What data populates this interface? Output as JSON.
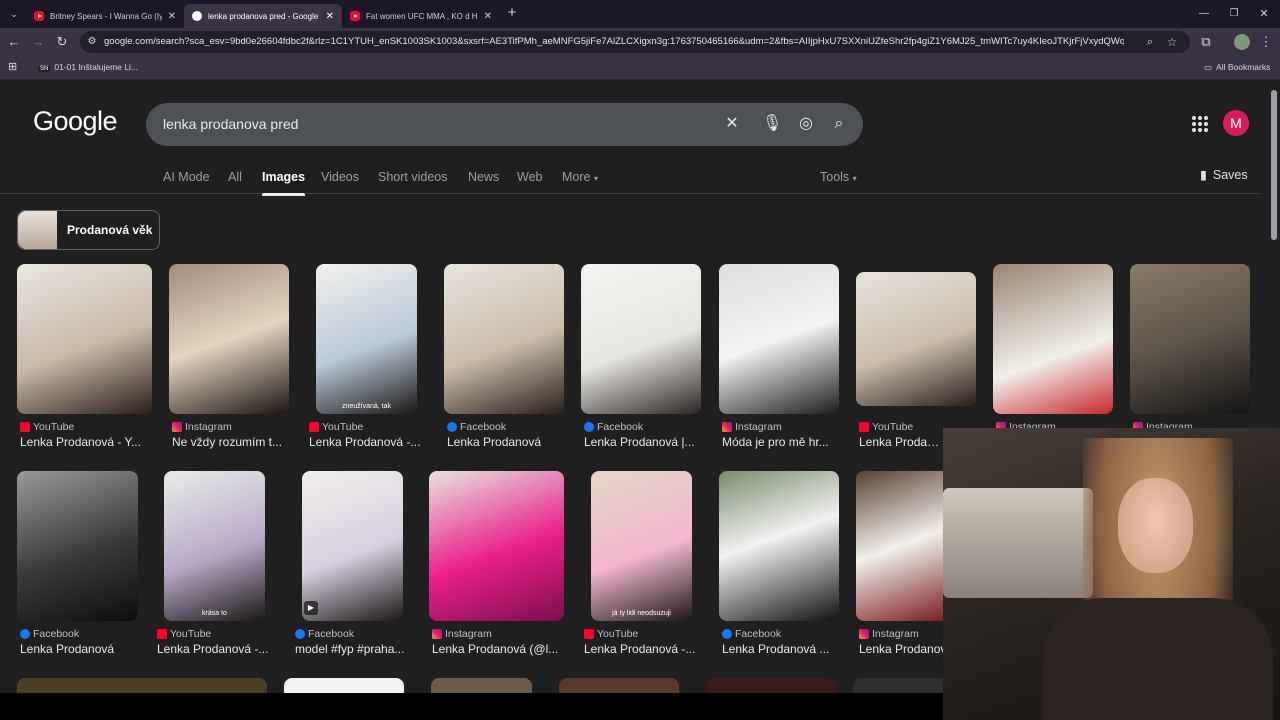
{
  "browser": {
    "tabs": [
      {
        "title": "Britney Spears - I Wanna Go (Iy",
        "favicon": "youtube-icon",
        "active": false
      },
      {
        "title": "lenka prodanova pred - Google",
        "favicon": "google-icon",
        "active": true
      },
      {
        "title": "Fat women UFC MMA , KO d H",
        "favicon": "youtube-icon",
        "active": false
      }
    ],
    "new_tab": "+",
    "url": "google.com/search?sca_esv=9bd0e26604fdbc2f&rlz=1C1YTUH_enSK1003SK1003&sxsrf=AE3TifPMh_aeMNFG5jiFe7AlZLCXigxn3g:1763750465166&udm=2&fbs=AIIjpHxU7SXXniUZfeShr2fp4giZ1Y6MJ25_tmWITc7uy4KIeoJTKjrFjVxydQWqI2NcOhYPUR...",
    "bookmarks": {
      "item": "01-01 Inštalujeme Li...",
      "all": "All Bookmarks",
      "item_badge": "SN"
    }
  },
  "google": {
    "logo": "Google",
    "query": "lenka prodanova pred",
    "avatar_letter": "M",
    "nav_tabs": [
      "AI Mode",
      "All",
      "Images",
      "Videos",
      "Short videos",
      "News",
      "Web",
      "More"
    ],
    "selected_tab": "Images",
    "tools": "Tools",
    "saves": "Saves",
    "chip": "Prodanová věk",
    "results_row1": [
      {
        "source": "YouTube",
        "icon": "youtube",
        "caption": "Lenka Prodanová - Y..."
      },
      {
        "source": "Instagram",
        "icon": "instagram",
        "caption": "Ne vždy rozumím t..."
      },
      {
        "source": "YouTube",
        "icon": "youtube",
        "caption": "Lenka Prodanová -...",
        "overlay": "zneužívaná, tak"
      },
      {
        "source": "Facebook",
        "icon": "facebook",
        "caption": "Lenka Prodanová"
      },
      {
        "source": "Facebook",
        "icon": "facebook",
        "caption": "Lenka Prodanová |..."
      },
      {
        "source": "Instagram",
        "icon": "instagram",
        "caption": "Móda je pro mě hr..."
      },
      {
        "source": "YouTube",
        "icon": "youtube",
        "caption": "Lenka Prodanová"
      },
      {
        "source": "Instagram",
        "icon": "instagram",
        "caption": ""
      },
      {
        "source": "Instagram",
        "icon": "instagram",
        "caption": ""
      }
    ],
    "results_row2": [
      {
        "source": "Facebook",
        "icon": "facebook",
        "caption": "Lenka Prodanová"
      },
      {
        "source": "YouTube",
        "icon": "youtube",
        "caption": "Lenka Prodanová -...",
        "overlay": "krása to"
      },
      {
        "source": "Facebook",
        "icon": "facebook",
        "caption": "model #fyp #praha..."
      },
      {
        "source": "Instagram",
        "icon": "instagram",
        "caption": "Lenka Prodanová (@l..."
      },
      {
        "source": "YouTube",
        "icon": "youtube",
        "caption": "Lenka Prodanová -...",
        "overlay": "já ty lidi neodsuzuji"
      },
      {
        "source": "Facebook",
        "icon": "facebook",
        "caption": "Lenka Prodanová ..."
      },
      {
        "source": "Instagram",
        "icon": "instagram",
        "caption": "Lenka Prodanov"
      }
    ]
  }
}
